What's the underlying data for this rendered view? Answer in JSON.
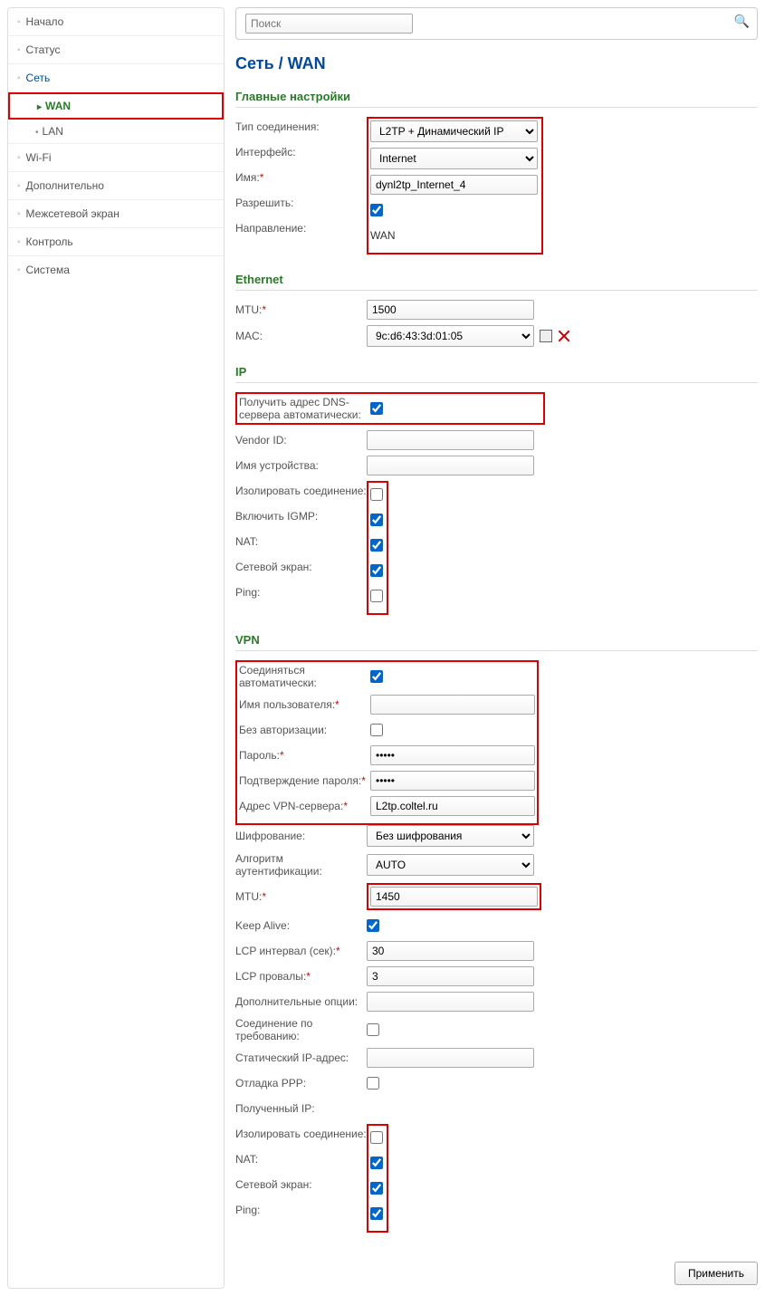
{
  "search": {
    "placeholder": "Поиск"
  },
  "breadcrumb": "Сеть /  WAN",
  "sidebar": {
    "items": [
      {
        "label": "Начало"
      },
      {
        "label": "Статус"
      },
      {
        "label": "Сеть",
        "active": true
      },
      {
        "label": "Wi-Fi"
      },
      {
        "label": "Дополнительно"
      },
      {
        "label": "Межсетевой экран"
      },
      {
        "label": "Контроль"
      },
      {
        "label": "Система"
      }
    ],
    "subs": [
      {
        "label": "WAN",
        "active": true
      },
      {
        "label": "LAN",
        "active": false
      }
    ]
  },
  "sections": {
    "main": {
      "title": "Главные настройки",
      "conn_type_label": "Тип соединения:",
      "conn_type_value": "L2TP + Динамический IP",
      "iface_label": "Интерфейс:",
      "iface_value": "Internet",
      "name_label": "Имя:",
      "name_value": "dynl2tp_Internet_4",
      "allow_label": "Разрешить:",
      "allow_checked": true,
      "dir_label": "Направление:",
      "dir_value": "WAN"
    },
    "eth": {
      "title": "Ethernet",
      "mtu_label": "MTU:",
      "mtu_value": "1500",
      "mac_label": "MAC:",
      "mac_value": "9c:d6:43:3d:01:05"
    },
    "ip": {
      "title": "IP",
      "dns_auto_label": "Получить адрес DNS-сервера автоматически:",
      "dns_auto_checked": true,
      "vendor_label": "Vendor ID:",
      "vendor_value": "",
      "devname_label": "Имя устройства:",
      "devname_value": "",
      "isolate_label": "Изолировать соединение:",
      "isolate_checked": false,
      "igmp_label": "Включить IGMP:",
      "igmp_checked": true,
      "nat_label": "NAT:",
      "nat_checked": true,
      "fw_label": "Сетевой экран:",
      "fw_checked": true,
      "ping_label": "Ping:",
      "ping_checked": false
    },
    "vpn": {
      "title": "VPN",
      "auto_label": "Соединяться автоматически:",
      "auto_checked": true,
      "user_label": "Имя пользователя:",
      "user_value": "",
      "noauth_label": "Без авторизации:",
      "noauth_checked": false,
      "pass_label": "Пароль:",
      "pass_value": "•••••",
      "pass2_label": "Подтверждение пароля:",
      "pass2_value": "•••••",
      "srv_label": "Адрес VPN-сервера:",
      "srv_value": "L2tp.coltel.ru",
      "enc_label": "Шифрование:",
      "enc_value": "Без шифрования",
      "auth_label": "Алгоритм аутентификации:",
      "auth_value": "AUTO",
      "mtu_label": "MTU:",
      "mtu_value": "1450",
      "keep_label": "Keep Alive:",
      "keep_checked": true,
      "lcpi_label": "LCP интервал (сек):",
      "lcpi_value": "30",
      "lcpf_label": "LCP провалы:",
      "lcpf_value": "3",
      "extra_label": "Дополнительные опции:",
      "extra_value": "",
      "ondem_label": "Соединение по требованию:",
      "ondem_checked": false,
      "static_label": "Статический IP-адрес:",
      "static_value": "",
      "debug_label": "Отладка PPP:",
      "debug_checked": false,
      "recv_label": "Полученный IP:",
      "recv_value": "",
      "iso2_label": "Изолировать соединение:",
      "iso2_checked": false,
      "nat2_label": "NAT:",
      "nat2_checked": true,
      "fw2_label": "Сетевой экран:",
      "fw2_checked": true,
      "ping2_label": "Ping:",
      "ping2_checked": true
    }
  },
  "footer": {
    "apply": "Применить"
  }
}
